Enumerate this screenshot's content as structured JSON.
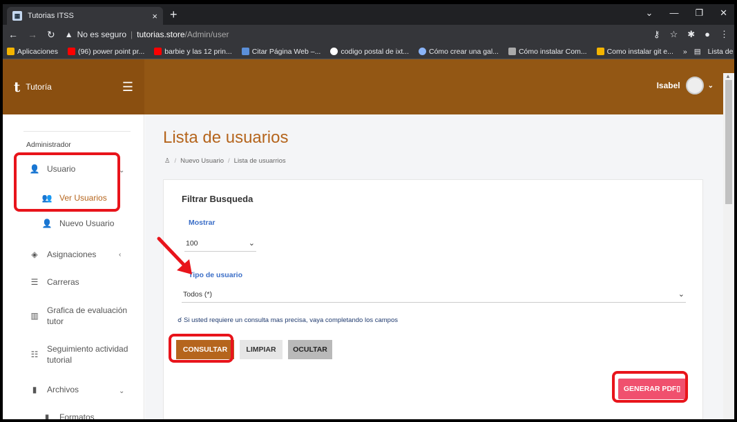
{
  "browser": {
    "tab_title": "Tutorias ITSS",
    "tab_close": "×",
    "new_tab": "+",
    "security": "No es seguro",
    "url_host": "tutorias.store",
    "url_path": "/Admin/user",
    "bookmarks": [
      {
        "label": "Aplicaciones",
        "color": "#f4b400"
      },
      {
        "label": "(96) power point pr...",
        "color": "#ff0000"
      },
      {
        "label": "barbie y las 12 prin...",
        "color": "#ff0000"
      },
      {
        "label": "Citar Página Web –...",
        "color": "#5b8fd8"
      },
      {
        "label": "codigo postal de ixt...",
        "color": "#ffffff"
      },
      {
        "label": "Cómo crear una gal...",
        "color": "#8ab4f8"
      },
      {
        "label": "Cómo instalar Com...",
        "color": "#aaaaaa"
      },
      {
        "label": "Como instalar git e...",
        "color": "#f4b400"
      }
    ],
    "bookmarks_more": "»",
    "reading_list": "Lista de lectura"
  },
  "header": {
    "logo": "t",
    "brand": "Tutoría",
    "user_name": "Isabel"
  },
  "sidebar": {
    "heading": "Administrador",
    "items": {
      "usuario": "Usuario",
      "ver_usuarios": "Ver Usuarios",
      "nuevo_usuario": "Nuevo Usuario",
      "asignaciones": "Asignaciones",
      "carreras": "Carreras",
      "grafica_1": "Grafica de evaluación",
      "grafica_2": "tutor",
      "seguimiento_1": "Seguimiento actividad",
      "seguimiento_2": "tutorial",
      "archivos": "Archivos",
      "formatos": "Formatos"
    }
  },
  "main": {
    "title": "Lista de usuarios",
    "breadcrumb": [
      "Nuevo Usuario",
      "Lista de usuarrios"
    ],
    "filter_title": "Filtrar Busqueda",
    "show_label": "Mostrar",
    "show_value": "100",
    "type_label": "Tipo de usuario",
    "type_value": "Todos (*)",
    "hint": "Si usted requiere un consulta mas precisa, vaya completando los campos",
    "btn_consultar": "CONSULTAR",
    "btn_limpiar": "LIMPIAR",
    "btn_ocultar": "OCULTAR",
    "btn_pdf": "GENERAR PDF"
  },
  "colors": {
    "header": "#935714",
    "accent": "#b5651d",
    "pdf_button": "#f0506e",
    "annotation": "#e8141b"
  }
}
